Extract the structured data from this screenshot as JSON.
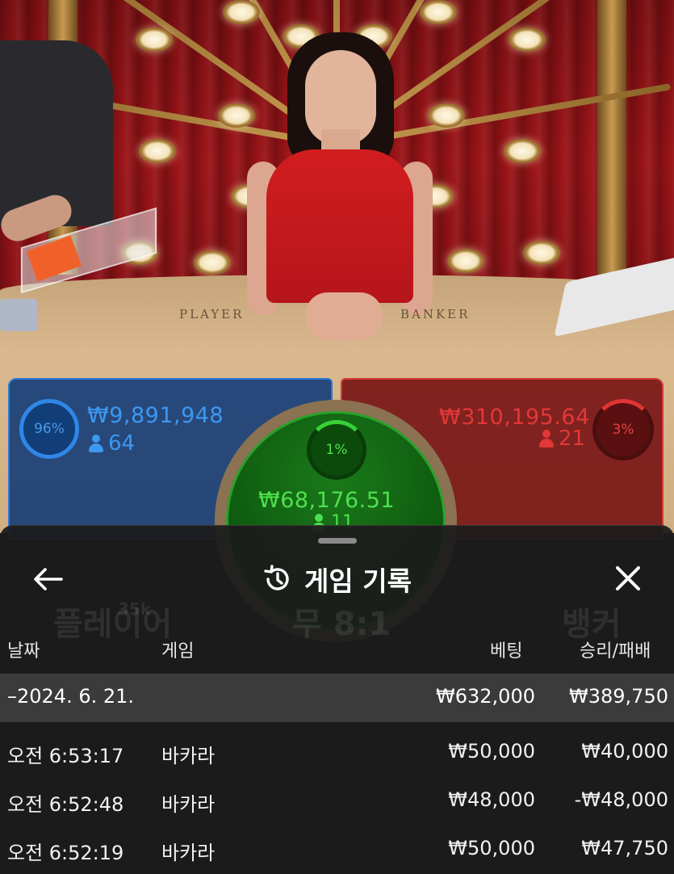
{
  "video": {
    "table_label_left": "PLAYER",
    "table_label_right": "BANKER"
  },
  "bets": {
    "player": {
      "percent": "96%",
      "amount": "₩9,891,948",
      "players": "64",
      "color": "#2f86e8"
    },
    "tie": {
      "percent": "1%",
      "amount": "₩68,176.51",
      "players": "11",
      "color": "#36d136"
    },
    "banker": {
      "percent": "3%",
      "amount": "₩310,195.64",
      "players": "21",
      "color": "#e23434"
    }
  },
  "background_labels": {
    "player": "플레이어",
    "tie": "무 8:1",
    "banker": "뱅커",
    "player_chip": "35k"
  },
  "sheet": {
    "title": "게임 기록",
    "back_icon": "arrow-left-icon",
    "history_icon": "history-icon",
    "close_icon": "close-icon",
    "columns": {
      "date": "날짜",
      "game": "게임",
      "bet": "베팅",
      "result": "승리/패배"
    },
    "summary": {
      "date": "–2024. 6. 21.",
      "bet": "₩632,000",
      "result": "₩389,750"
    },
    "rows": [
      {
        "time": "오전 6:53:17",
        "game": "바카라",
        "bet": "₩50,000",
        "result": "₩40,000"
      },
      {
        "time": "오전 6:52:48",
        "game": "바카라",
        "bet": "₩48,000",
        "result": "-₩48,000"
      },
      {
        "time": "오전 6:52:19",
        "game": "바카라",
        "bet": "₩50,000",
        "result": "₩47,750"
      }
    ]
  }
}
